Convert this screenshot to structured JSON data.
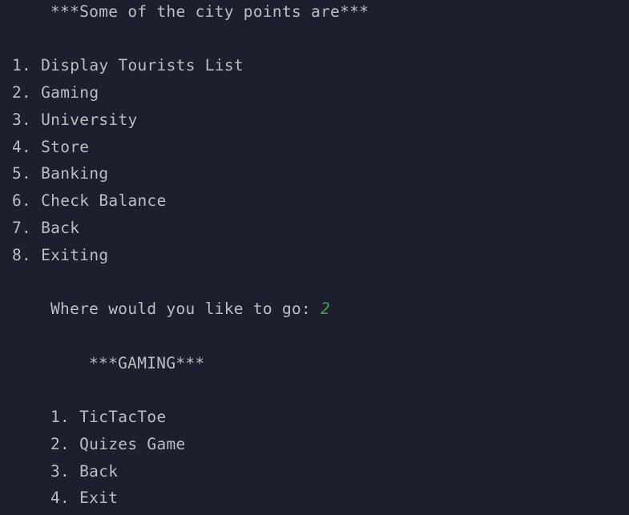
{
  "console": {
    "header": "***Some of the city points are***",
    "menu": [
      "1. Display Tourists List",
      "2. Gaming",
      "3. University",
      "4. Store",
      "5. Banking",
      "6. Check Balance",
      "7. Back",
      "8. Exiting"
    ],
    "prompt": {
      "label": "Where would you like to go: ",
      "input": "2"
    },
    "gaming": {
      "header": "***GAMING***",
      "menu": [
        "1. TicTacToe",
        "2. Quizes Game",
        "3. Back",
        "4. Exit"
      ]
    }
  },
  "colors": {
    "background": "#1e1f2e",
    "text": "#bcbec4",
    "input": "#3aa14a"
  }
}
